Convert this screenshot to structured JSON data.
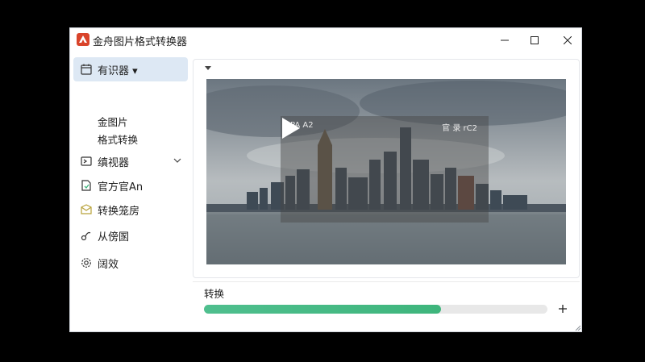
{
  "window": {
    "title": "金舟图片格式转换器",
    "controls": [
      "minimize",
      "maximize",
      "close"
    ]
  },
  "sidebar": {
    "items": [
      {
        "label": "有识器 ▾",
        "icon": "calendar-icon",
        "active": true
      },
      {
        "label": "金图片",
        "sub": true
      },
      {
        "label": "格式转换",
        "sub": true
      },
      {
        "label": "缜视器",
        "icon": "video-icon",
        "expandable": true
      },
      {
        "label": "官方官An",
        "icon": "document-icon"
      },
      {
        "label": "转换笼房",
        "icon": "envelope-icon"
      },
      {
        "label": "从傍圂",
        "icon": "link-icon"
      },
      {
        "label": "阔效",
        "icon": "gear-icon"
      }
    ]
  },
  "preview": {
    "overlay_left_text": "PA A2",
    "overlay_right_text": "官 录 rC2",
    "play_icon": "play-icon"
  },
  "convert": {
    "label": "转换",
    "progress": 0.69,
    "add_icon": "plus-icon"
  },
  "colors": {
    "accent": "#4fbf8e",
    "active_bg": "#dde8f4",
    "app_icon": "#d9442b"
  }
}
